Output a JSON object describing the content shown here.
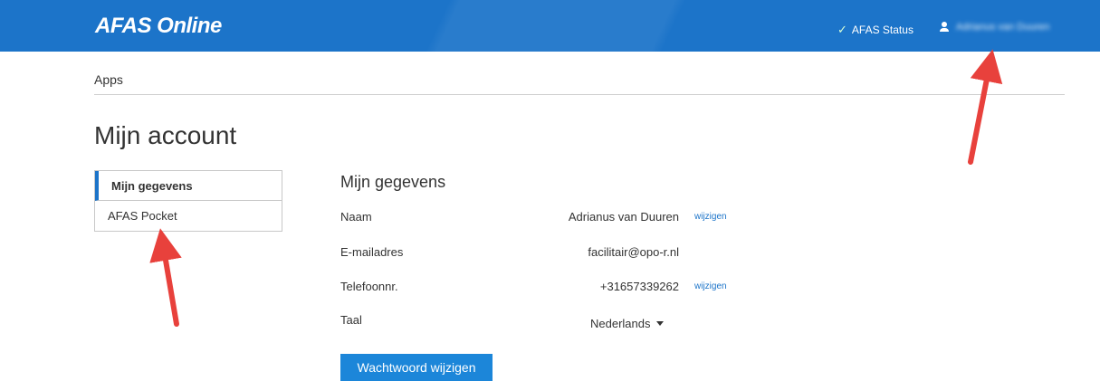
{
  "header": {
    "logo": "AFAS Online",
    "status_label": "AFAS Status",
    "user_name": "Adrianus van Duuren",
    "accent": "#1c74c9"
  },
  "breadcrumb": "Apps",
  "page_title": "Mijn account",
  "sidenav": {
    "items": [
      {
        "label": "Mijn gegevens",
        "active": true
      },
      {
        "label": "AFAS Pocket",
        "active": false
      }
    ]
  },
  "details": {
    "title": "Mijn gegevens",
    "rows": [
      {
        "label": "Naam",
        "value": "Adrianus van Duuren",
        "link": "wijzigen"
      },
      {
        "label": "E-mailadres",
        "value": "facilitair@opo-r.nl",
        "link": ""
      },
      {
        "label": "Telefoonnr.",
        "value": "+31657339262",
        "link": "wijzigen"
      },
      {
        "label": "Taal",
        "value": "Nederlands",
        "link": ""
      }
    ],
    "password_button": "Wachtwoord wijzigen"
  },
  "annotations": {
    "arrow_color": "#e8413c"
  }
}
